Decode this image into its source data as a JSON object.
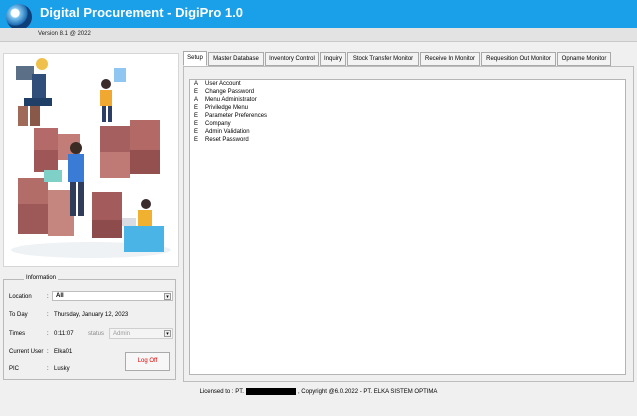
{
  "app": {
    "title": "Digital Procurement - DigiPro 1.0",
    "version": "Version 8.1 @ 2022"
  },
  "tabs": [
    {
      "label": "Setup",
      "active": true
    },
    {
      "label": "Master Database"
    },
    {
      "label": "Inventory Control"
    },
    {
      "label": "Inquiry"
    },
    {
      "label": "Stock Transfer Monitor"
    },
    {
      "label": "Receive In Monitor"
    },
    {
      "label": "Requesition Out Monitor"
    },
    {
      "label": "Opname Monitor"
    }
  ],
  "setup_items": [
    {
      "code": "A",
      "label": "User Account"
    },
    {
      "code": "E",
      "label": "Change Password"
    },
    {
      "code": "A",
      "label": "Menu Administrator"
    },
    {
      "code": "E",
      "label": "Priviledge Menu"
    },
    {
      "code": "E",
      "label": "Parameter Preferences"
    },
    {
      "code": "E",
      "label": "Company"
    },
    {
      "code": "E",
      "label": "Admin Validation"
    },
    {
      "code": "E",
      "label": "Reset Password"
    }
  ],
  "info": {
    "legend": "Information",
    "location_label": "Location",
    "location_value": "All",
    "today_label": "To Day",
    "today_value": "Thursday, January 12, 2023",
    "times_label": "Times",
    "times_value": "0:11:07",
    "status_label": "status",
    "status_value": "Admin",
    "current_user_label": "Current User",
    "current_user_value": "Elka01",
    "pic_label": "PIC",
    "pic_value": "Lusky",
    "logoff_label": "Log Off",
    "colon": ":"
  },
  "footer": {
    "licensed_prefix": "Licensed to : PT.",
    "licensed_suffix": ", Copyright @6.0.2022 - PT. ELKA SISTEM OPTIMA"
  },
  "colors": {
    "titlebar": "#1aa0e8",
    "logoff_text": "#dd0000"
  },
  "icons": {
    "app_logo": "globe-arrow-logo",
    "illustration": "warehouse-illustration"
  }
}
